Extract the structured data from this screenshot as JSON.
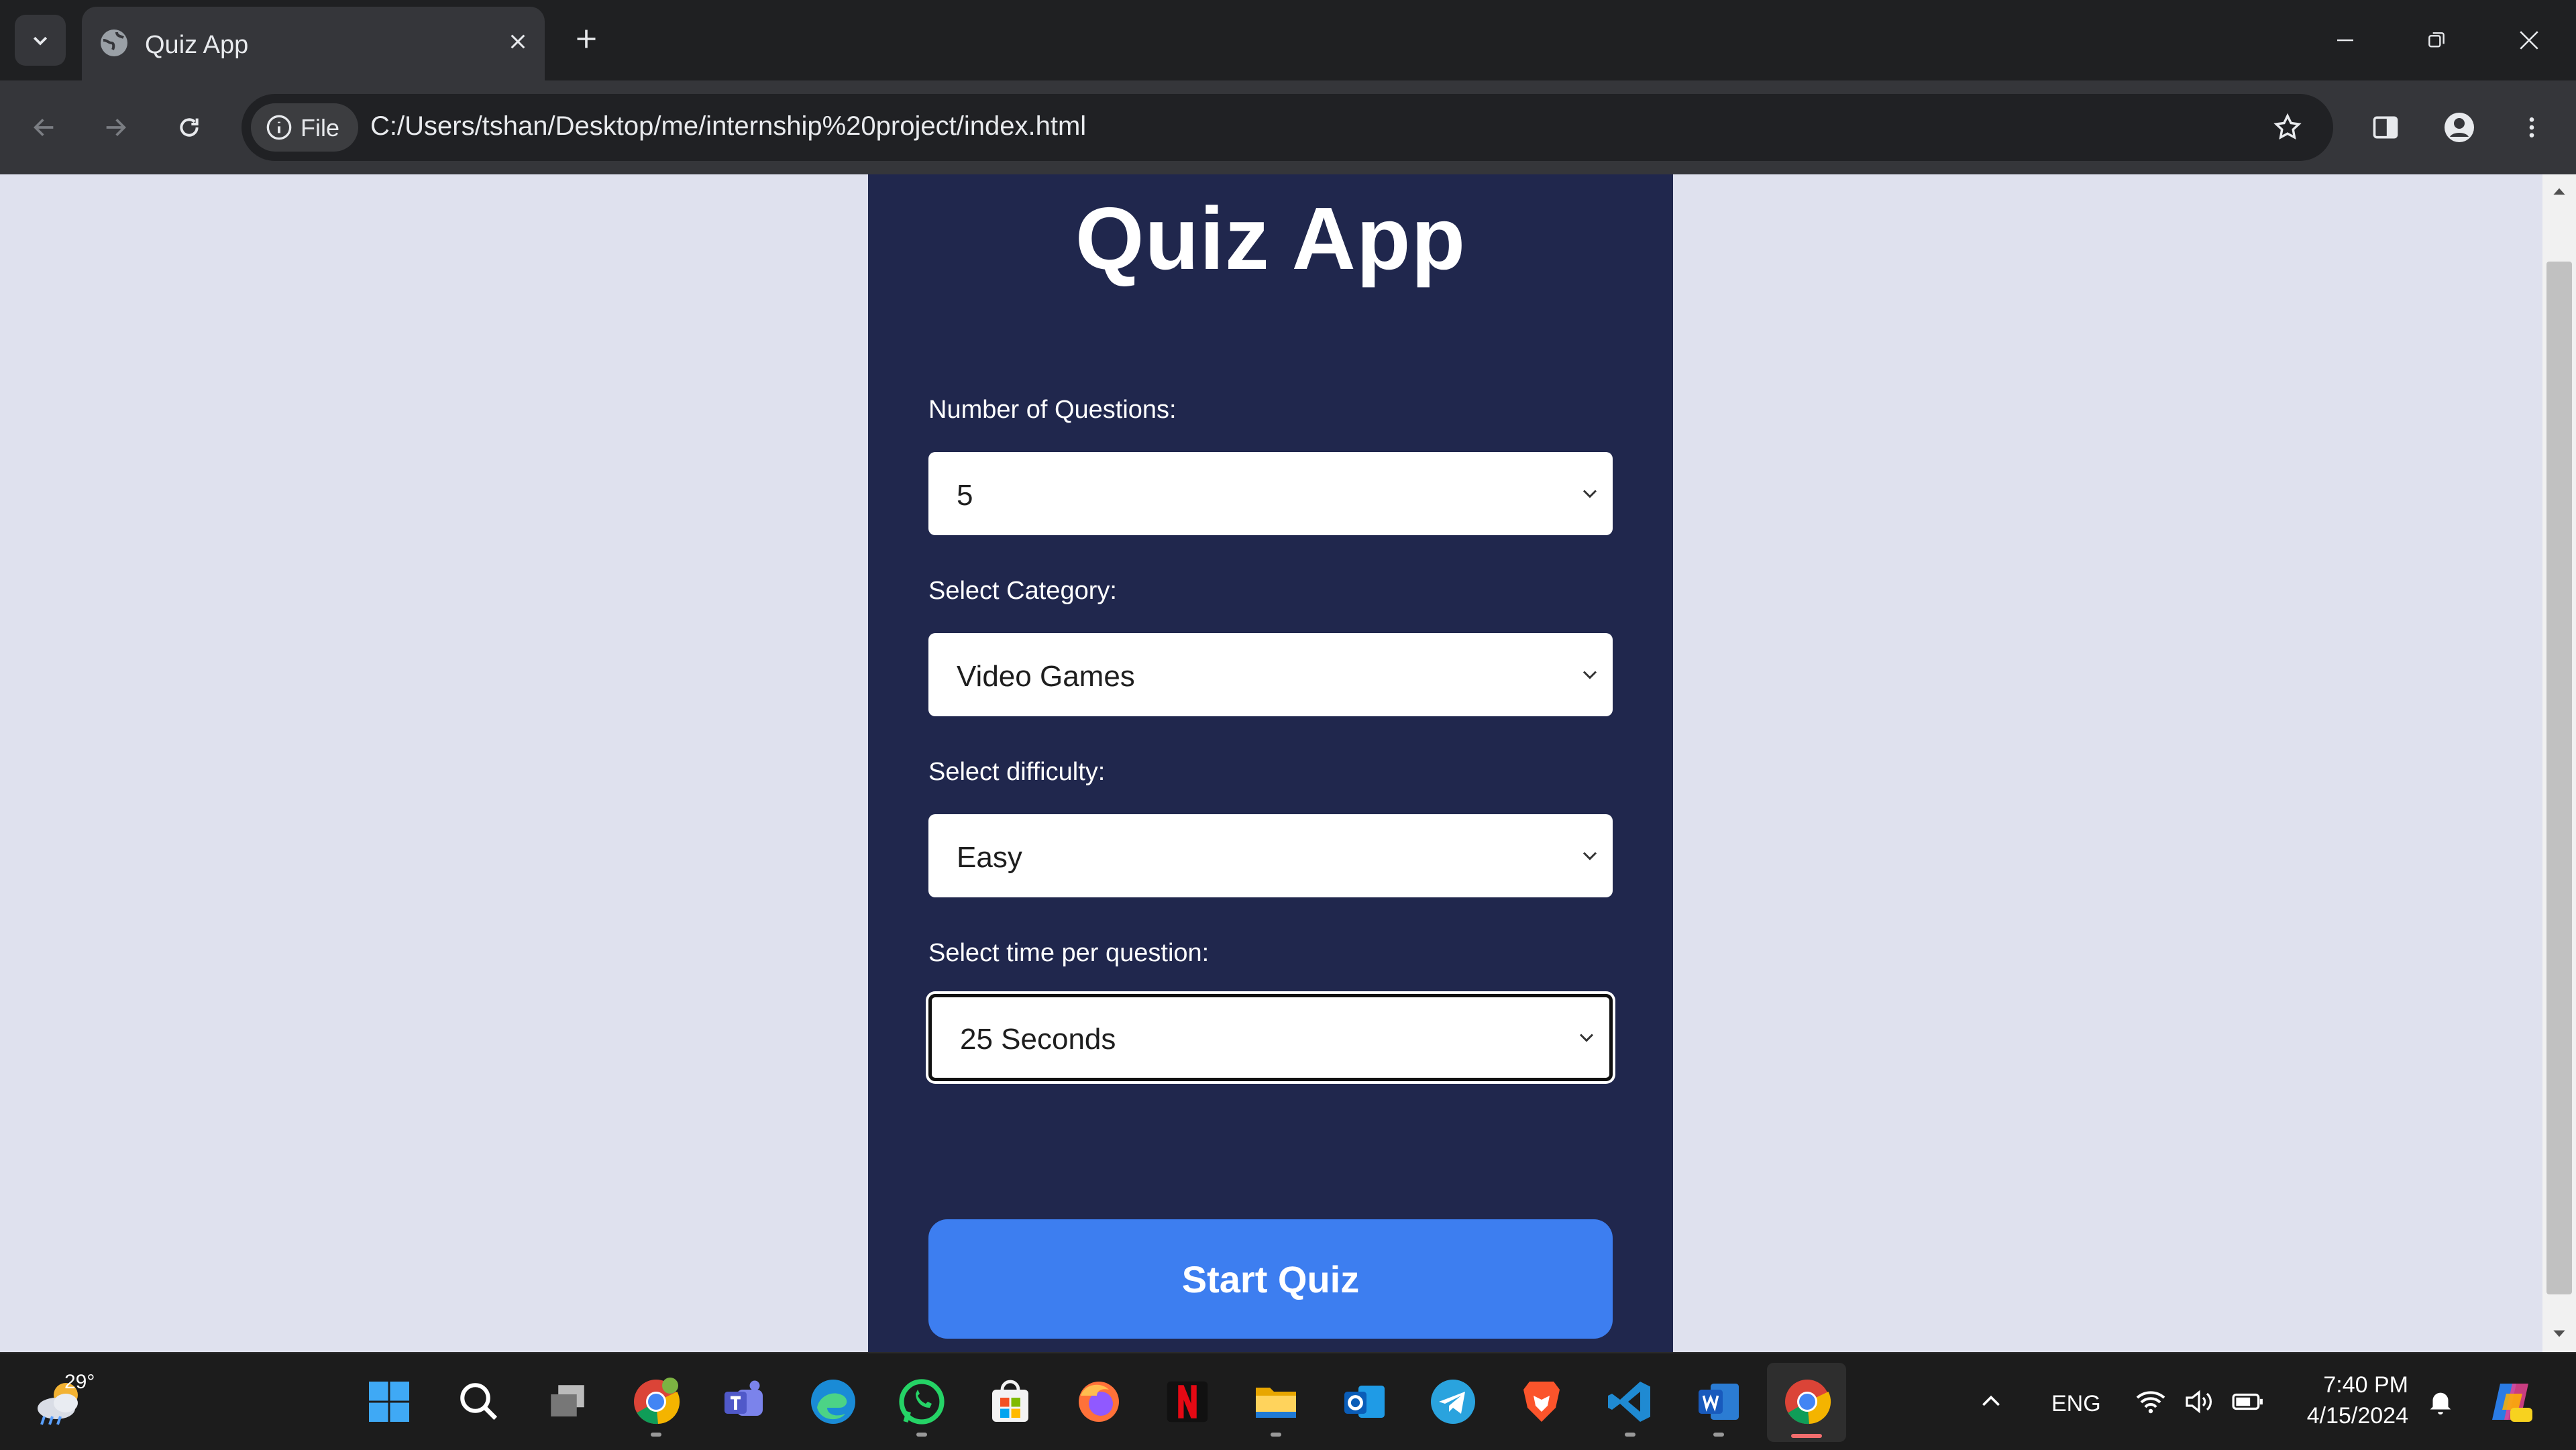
{
  "browser": {
    "tab_title": "Quiz App",
    "file_chip_label": "File",
    "url": "C:/Users/tshan/Desktop/me/internship%20project/index.html"
  },
  "page": {
    "title": "Quiz App",
    "fields": [
      {
        "label": "Number of Questions:",
        "value": "5"
      },
      {
        "label": "Select Category:",
        "value": "Video Games"
      },
      {
        "label": "Select difficulty:",
        "value": "Easy"
      },
      {
        "label": "Select time per question:",
        "value": "25 Seconds"
      }
    ],
    "start_button": "Start Quiz",
    "colors": {
      "card": "#20274d",
      "button": "#3d7ef0",
      "page_bg": "#dfe1ee"
    }
  },
  "taskbar": {
    "weather_temp": "29°",
    "language": "ENG",
    "time": "7:40 PM",
    "date": "4/15/2024",
    "icons": [
      "windows-start-icon",
      "search-icon",
      "task-view-icon",
      "chrome-icon",
      "teams-icon",
      "edge-icon",
      "whatsapp-icon",
      "store-icon",
      "firefox-icon",
      "netflix-icon",
      "file-explorer-icon",
      "outlook-icon",
      "telegram-icon",
      "brave-icon",
      "vscode-icon",
      "word-icon",
      "chrome-active-icon"
    ]
  }
}
